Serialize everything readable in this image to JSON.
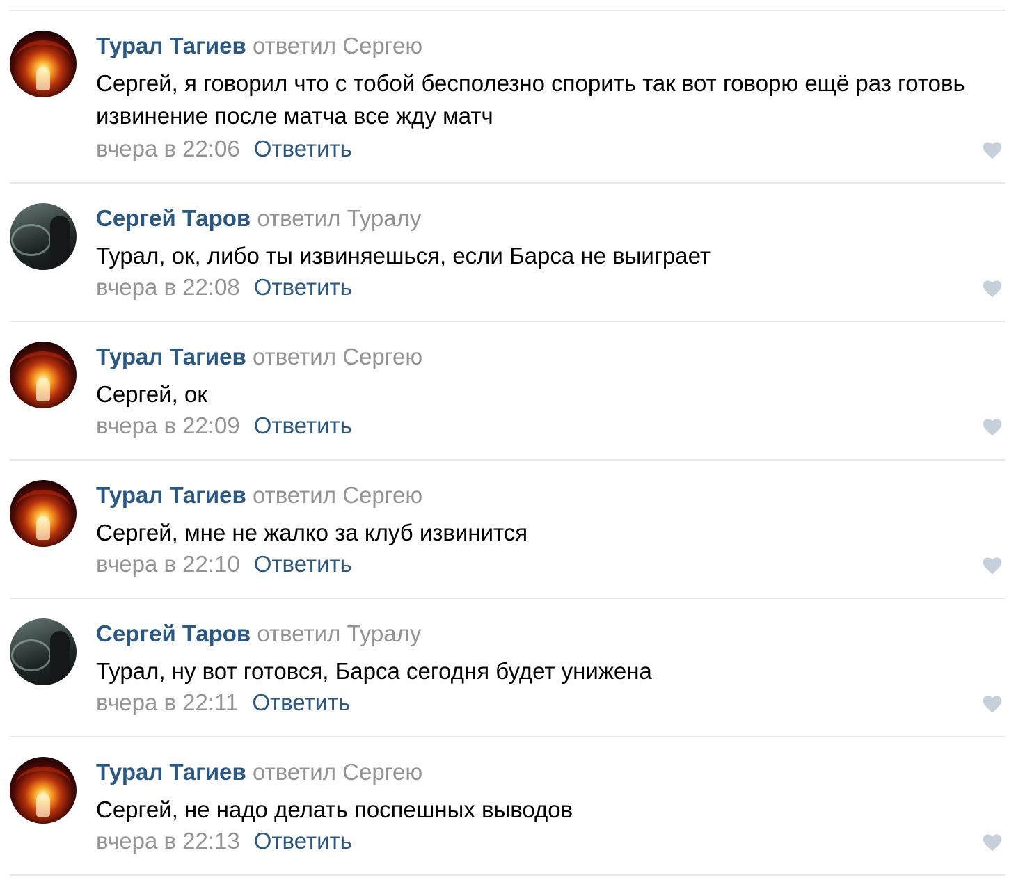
{
  "comments": [
    {
      "author": "Турал Тагиев",
      "reply_to": "ответил Сергею",
      "text": "Сергей, я говорил что с тобой бесполезно спорить так вот говорю ещё раз готовь извинение после матча все жду матч",
      "time": "вчера в 22:06",
      "reply_label": "Ответить"
    },
    {
      "author": "Сергей Таров",
      "reply_to": "ответил Туралу",
      "text": "Турал, ок, либо ты извиняешься, если Барса не выиграет",
      "time": "вчера в 22:08",
      "reply_label": "Ответить"
    },
    {
      "author": "Турал Тагиев",
      "reply_to": "ответил Сергею",
      "text": "Сергей, ок",
      "time": "вчера в 22:09",
      "reply_label": "Ответить"
    },
    {
      "author": "Турал Тагиев",
      "reply_to": "ответил Сергею",
      "text": "Сергей, мне не жалко за клуб извинится",
      "time": "вчера в 22:10",
      "reply_label": "Ответить"
    },
    {
      "author": "Сергей Таров",
      "reply_to": "ответил Туралу",
      "text": "Турал, ну вот готовся, Барса сегодня будет унижена",
      "time": "вчера в 22:11",
      "reply_label": "Ответить"
    },
    {
      "author": "Турал Тагиев",
      "reply_to": "ответил Сергею",
      "text": "Сергей, не надо делать поспешных выводов",
      "time": "вчера в 22:13",
      "reply_label": "Ответить"
    }
  ],
  "icons": {
    "like": "heart-icon"
  },
  "colors": {
    "author_link": "#2a5885",
    "secondary_text": "#939393",
    "body_text": "#000000",
    "divider": "#e7e8ec",
    "like_icon": "#c5d0db"
  }
}
